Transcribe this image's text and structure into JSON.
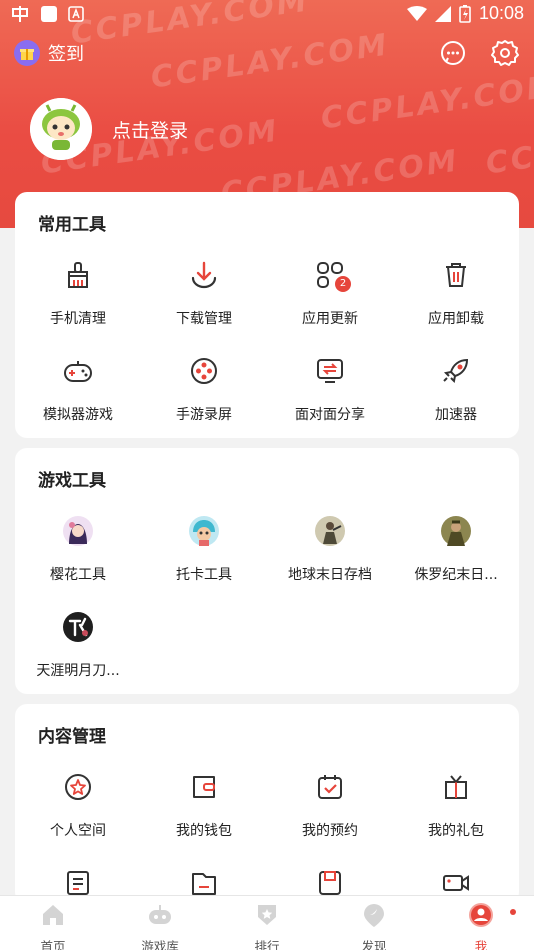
{
  "status_bar": {
    "time": "10:08"
  },
  "watermark": "CCPLAY.COM",
  "header": {
    "signin_label": "签到",
    "login_prompt": "点击登录"
  },
  "common_tools": {
    "title": "常用工具",
    "items": [
      {
        "label": "手机清理",
        "icon": "broom-icon"
      },
      {
        "label": "下载管理",
        "icon": "download-icon"
      },
      {
        "label": "应用更新",
        "icon": "app-update-icon",
        "badge": "2"
      },
      {
        "label": "应用卸载",
        "icon": "trash-icon"
      },
      {
        "label": "模拟器游戏",
        "icon": "gamepad-icon"
      },
      {
        "label": "手游录屏",
        "icon": "film-reel-icon"
      },
      {
        "label": "面对面分享",
        "icon": "share-screen-icon"
      },
      {
        "label": "加速器",
        "icon": "rocket-icon"
      }
    ]
  },
  "game_tools": {
    "title": "游戏工具",
    "items": [
      {
        "label": "樱花工具",
        "icon_color": "#6a4fa0"
      },
      {
        "label": "托卡工具",
        "icon_color": "#4fc3d9"
      },
      {
        "label": "地球末日存档",
        "icon_color": "#7a7255"
      },
      {
        "label": "侏罗纪末日...",
        "icon_color": "#6b6a35"
      },
      {
        "label": "天涯明月刀...",
        "icon_color": "#2a2a2a"
      }
    ]
  },
  "content_mgmt": {
    "title": "内容管理",
    "items": [
      {
        "label": "个人空间",
        "icon": "star-badge-icon"
      },
      {
        "label": "我的钱包",
        "icon": "wallet-icon"
      },
      {
        "label": "我的预约",
        "icon": "calendar-check-icon"
      },
      {
        "label": "我的礼包",
        "icon": "gift-box-icon"
      },
      {
        "label": "",
        "icon": "document-icon"
      },
      {
        "label": "",
        "icon": "folder-icon"
      },
      {
        "label": "",
        "icon": "save-icon"
      },
      {
        "label": "",
        "icon": "video-icon"
      }
    ]
  },
  "tabbar": {
    "tabs": [
      {
        "label": "首页",
        "icon": "home-icon"
      },
      {
        "label": "游戏库",
        "icon": "game-library-icon"
      },
      {
        "label": "排行",
        "icon": "ranking-icon"
      },
      {
        "label": "发现",
        "icon": "discover-icon"
      },
      {
        "label": "我",
        "icon": "me-icon",
        "active": true
      }
    ]
  },
  "colors": {
    "accent": "#e6453b",
    "hero": "#ea4c43"
  }
}
